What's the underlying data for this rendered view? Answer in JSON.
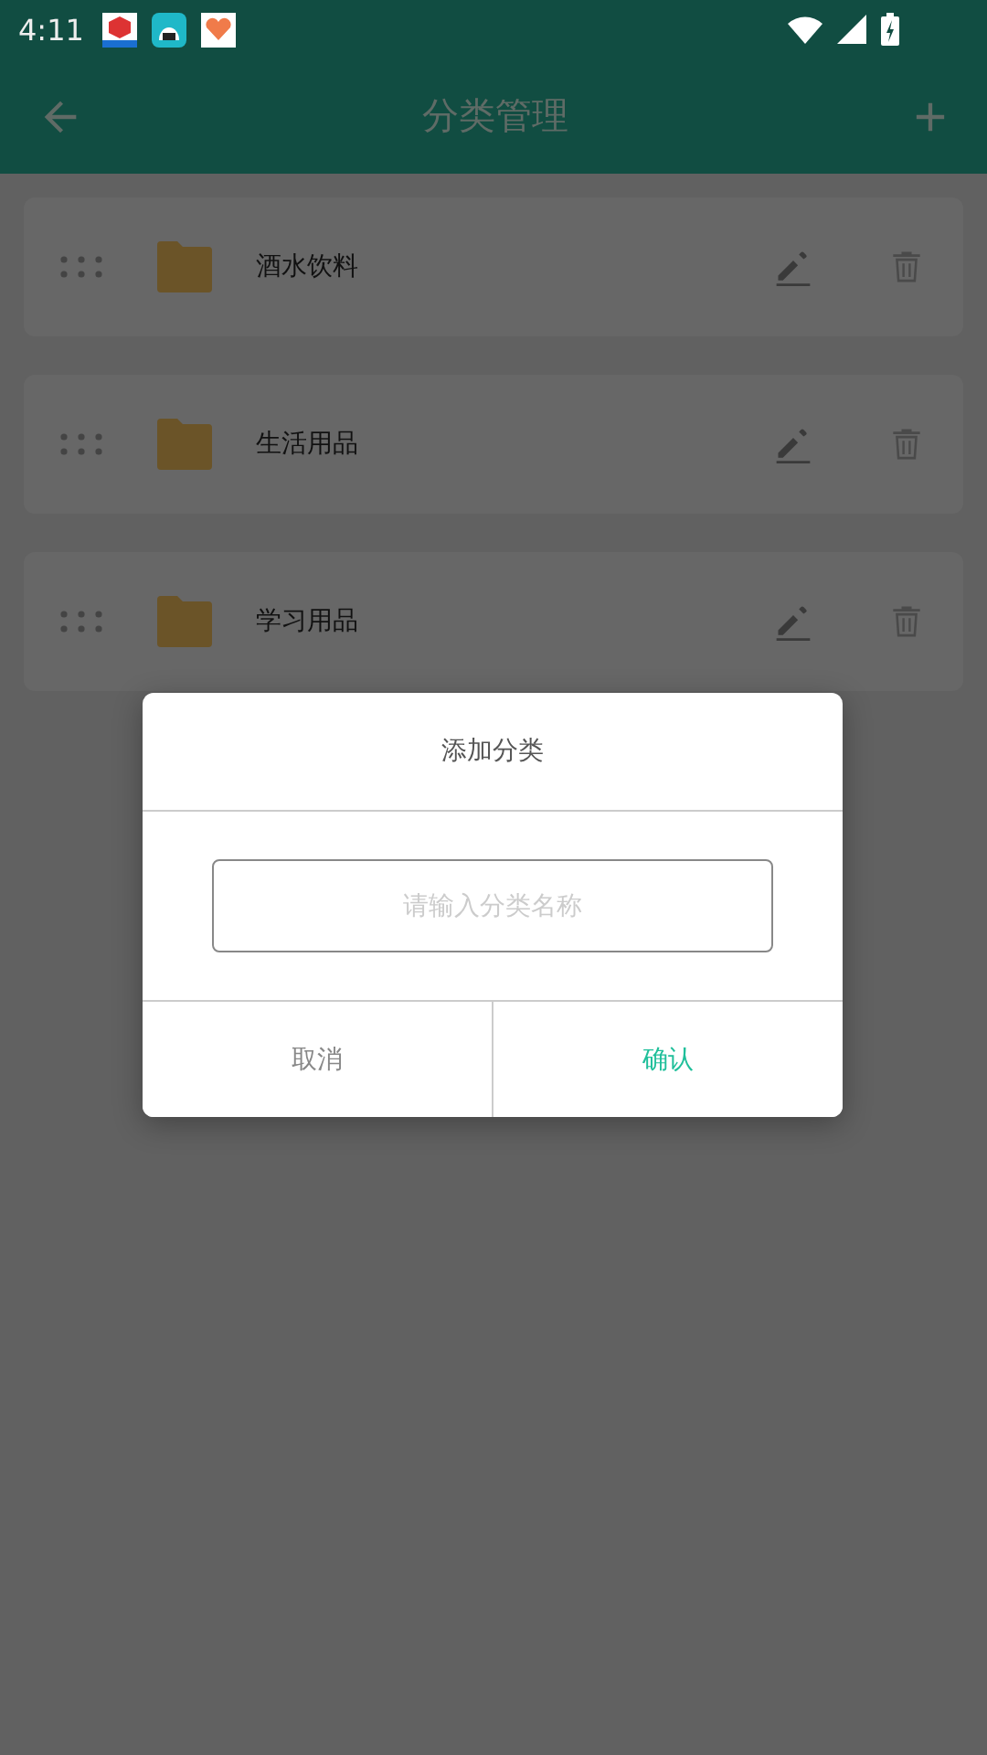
{
  "status_bar": {
    "time": "4:11"
  },
  "app_bar": {
    "title": "分类管理"
  },
  "categories": [
    {
      "name": "酒水饮料"
    },
    {
      "name": "生活用品"
    },
    {
      "name": "学习用品"
    }
  ],
  "dialog": {
    "title": "添加分类",
    "input": {
      "placeholder": "请输入分类名称"
    },
    "buttons": [
      {
        "label": "取消",
        "kind": "cancel"
      },
      {
        "label": "确认",
        "kind": "confirm"
      }
    ]
  }
}
